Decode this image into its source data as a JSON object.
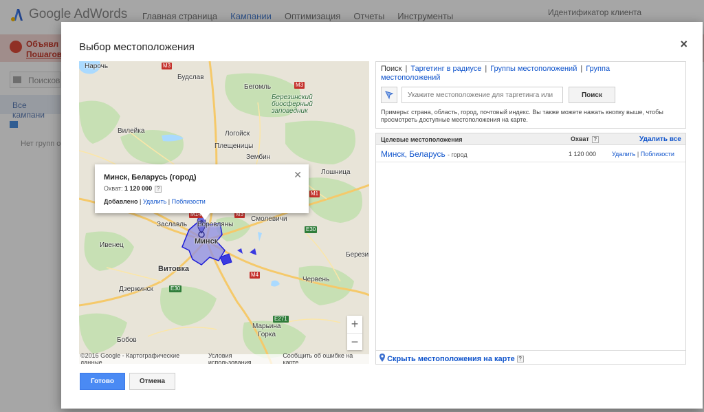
{
  "app": {
    "logo_text": "Google AdWords",
    "nav": [
      "Главная страница",
      "Кампании",
      "Оптимизация",
      "Отчеты",
      "Инструменты"
    ],
    "active_nav": "Кампании",
    "client_id_label": "Идентификатор клиента",
    "alert_line1": "Объявл",
    "alert_line2": "Пошагов",
    "search_placeholder": "Поисков",
    "all_campaigns": "Все кампани",
    "no_groups": "Нет групп об"
  },
  "modal": {
    "title": "Выбор местоположения",
    "close_symbol": "×",
    "done_label": "Готово",
    "cancel_label": "Отмена"
  },
  "map": {
    "labels": [
      "Нарочь",
      "Будслав",
      "Вилейка",
      "Логойск",
      "Плещеницы",
      "Бегомль",
      "Зембин",
      "Смолевичи",
      "Лошница",
      "Заславль",
      "Боровляны",
      "Минск",
      "Ивенец",
      "Витовка",
      "Дзержинск",
      "Марьина Горка",
      "Червень",
      "Березино",
      "Бобов",
      "Марьина",
      "Горка",
      "Березинский биосферный заповедник"
    ],
    "road_badges": [
      "M3",
      "M3",
      "M14",
      "M3",
      "M1",
      "E30",
      "M4",
      "E30",
      "E271"
    ],
    "footer": [
      "©2016 Google - Картографические данные",
      "Условия использования",
      "Сообщить об ошибке на карте"
    ],
    "zoom_in": "+",
    "zoom_out": "−",
    "popup": {
      "title": "Минск, Беларусь (город)",
      "reach_label": "Охват:",
      "reach_value": "1 120 000",
      "help": "?",
      "added": "Добавлено",
      "remove": "Удалить",
      "nearby": "Поблизости"
    }
  },
  "search": {
    "tab_search": "Поиск",
    "tab_radius": "Таргетинг в радиусе",
    "tab_groups": "Группы местоположений",
    "tab_group": "Группа",
    "tab_group_2": "местоположений",
    "input_placeholder": "Укажите местоположение для таргетинга или",
    "button": "Поиск",
    "examples": "Примеры: страна, область, город, почтовый индекс. Вы также можете нажать кнопку выше, чтобы просмотреть доступные местоположения на карте."
  },
  "targets": {
    "col_location": "Целевые местоположения",
    "col_reach": "Охват",
    "help": "?",
    "remove_all": "Удалить все",
    "rows": [
      {
        "name": "Минск, Беларусь",
        "type": "- город",
        "reach": "1 120 000",
        "remove": "Удалить",
        "nearby": "Поблизости"
      }
    ],
    "hide_map_link": "Скрыть местоположения на карте"
  },
  "colors": {
    "accent_blue": "#4a8af4",
    "link": "#1155cc",
    "minsk_polygon": "#6b6bd9",
    "road_badge": "#c4302b"
  }
}
